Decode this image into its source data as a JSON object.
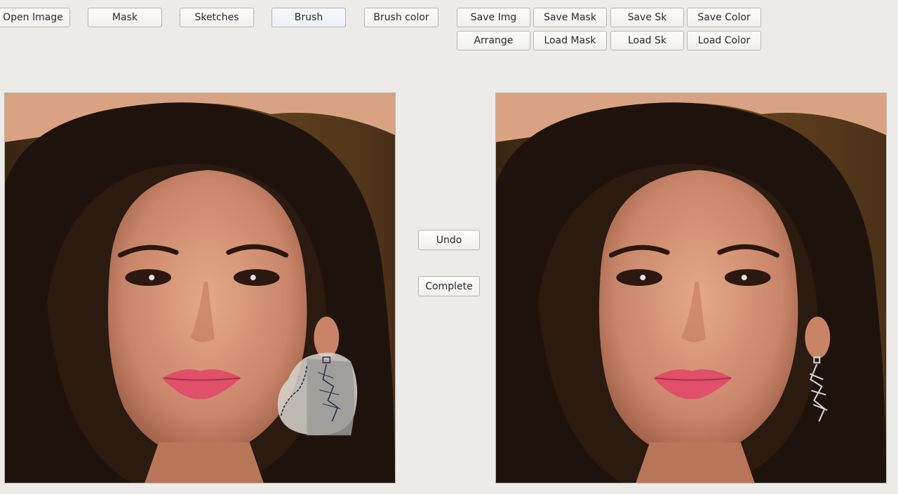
{
  "toolbar": {
    "open_image": "Open Image",
    "mask": "Mask",
    "sketches": "Sketches",
    "brush": "Brush",
    "brush_color": "Brush color",
    "save_img": "Save Img",
    "save_mask": "Save Mask",
    "save_sk": "Save Sk",
    "save_color": "Save Color",
    "arrange": "Arrange",
    "load_mask": "Load Mask",
    "load_sk": "Load Sk",
    "load_color": "Load Color"
  },
  "actions": {
    "undo": "Undo",
    "complete": "Complete"
  },
  "colors": {
    "background": "#ecebe7",
    "mask_overlay": "#d9d6d0",
    "sketch_stroke": "#1f2a44"
  }
}
